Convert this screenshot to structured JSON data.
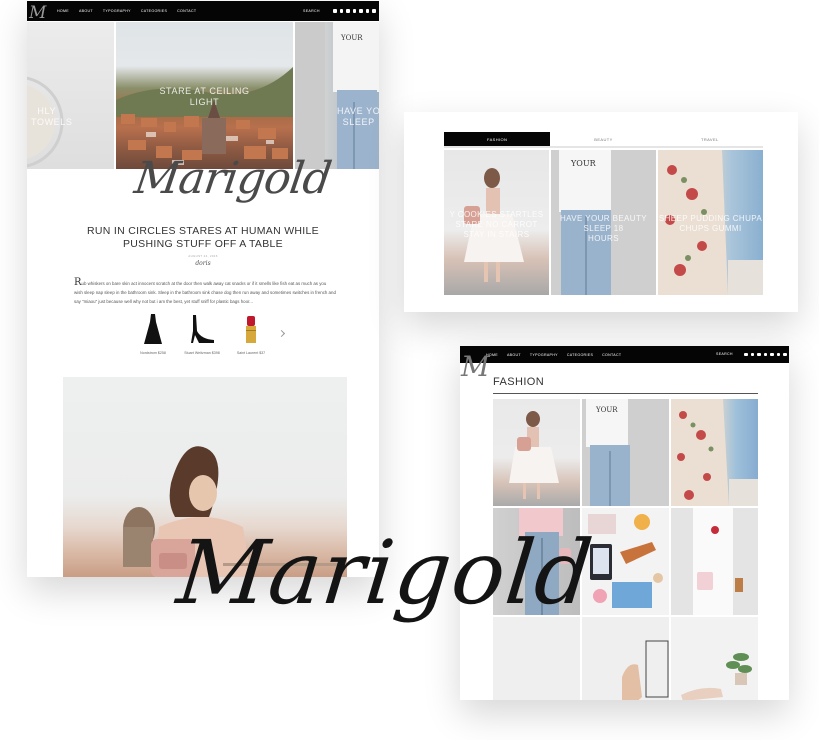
{
  "brand": {
    "name": "Marigold",
    "monogram": "M"
  },
  "nav": {
    "items": [
      "HOME",
      "ABOUT",
      "TYPOGRAPHY",
      "CATEGORIES",
      "CONTACT"
    ],
    "search_label": "SEARCH"
  },
  "home": {
    "slides": [
      {
        "text_line1": "HLY",
        "text_line2": "D TOWELS"
      },
      {
        "text_line1": "STARE AT CEILING",
        "text_line2": "LIGHT"
      },
      {
        "text_line1": "HAVE YO",
        "text_line2": "SLEEP"
      }
    ],
    "post": {
      "title": "RUN IN CIRCLES STARES AT HUMAN WHILE PUSHING STUFF OFF A TABLE",
      "date": "AUGUST 24, 2016",
      "signature": "doris",
      "excerpt_dropcap": "R",
      "excerpt": "ub whiskers on bare skin act innocent scratch at the door then walk away cat snacks or if it smells like fish eat as much as you wish sleep nap sleep in the bathroom sink. Sleep in the bathroom sink chase dog then run away and sometimes switches in french and say \"miaou\" just because well why not but i am the best, yet stuff sniff for plastic bags hoor..."
    },
    "products": [
      {
        "caption": "Nordstrom $258"
      },
      {
        "caption": "Stuart Weitzman $398"
      },
      {
        "caption": "Saint Laurent $37"
      }
    ]
  },
  "tabs_widget": {
    "tabs": [
      "FASHION",
      "BEAUTY",
      "TRAVEL"
    ],
    "active_tab": "FASHION",
    "tiles": [
      {
        "line1": "Y COOKIES STARTLES",
        "line2": "STARE NO CARROT",
        "line3": "STAY IN STAIRS"
      },
      {
        "line1": "HAVE YOUR BEAUTY SLEEP 18",
        "line2": "HOURS",
        "line3": ""
      },
      {
        "line1": "SHEEP PUDDING CHUPA",
        "line2": "CHUPS GUMMI",
        "line3": ""
      }
    ]
  },
  "category_page": {
    "title": "FASHION"
  },
  "colors": {
    "nav_bg": "#050505",
    "tab_active": "#050505",
    "text": "#333333"
  }
}
